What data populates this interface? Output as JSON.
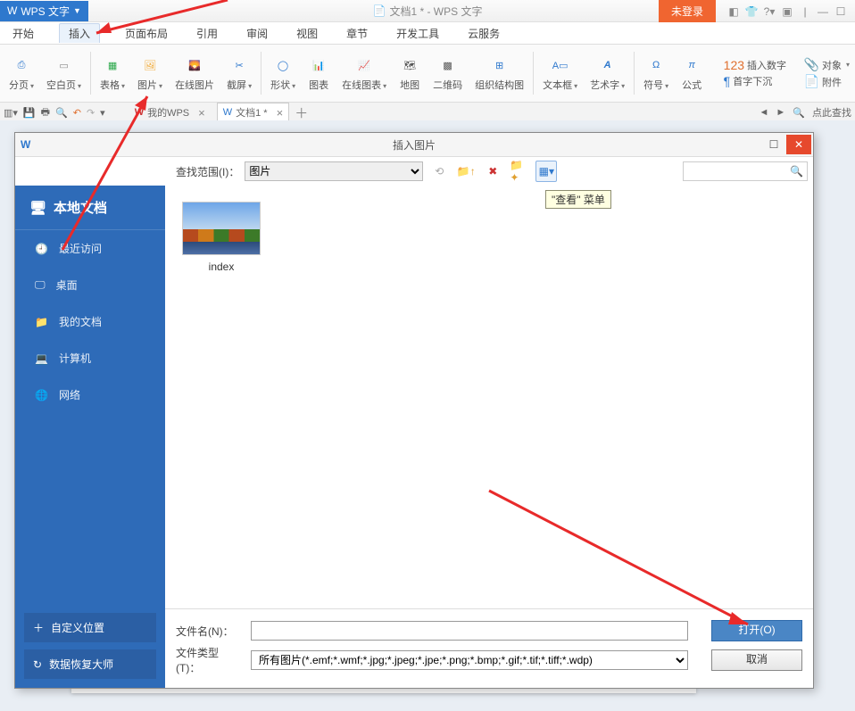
{
  "title": {
    "app": "WPS 文字",
    "doc": "文档1 * - WPS 文字",
    "login": "未登录"
  },
  "menu": {
    "items": [
      "开始",
      "插入",
      "页面布局",
      "引用",
      "审阅",
      "视图",
      "章节",
      "开发工具",
      "云服务"
    ],
    "active": 1
  },
  "ribbon": {
    "groups": [
      {
        "label": "分页",
        "drop": true
      },
      {
        "label": "空白页",
        "drop": true
      },
      {
        "label": "表格",
        "drop": true
      },
      {
        "label": "图片",
        "drop": true
      },
      {
        "label": "在线图片"
      },
      {
        "label": "截屏",
        "drop": true
      },
      {
        "label": "形状",
        "drop": true
      },
      {
        "label": "图表"
      },
      {
        "label": "在线图表",
        "drop": true
      },
      {
        "label": "地图"
      },
      {
        "label": "二维码"
      },
      {
        "label": "组织结构图"
      },
      {
        "label": "文本框",
        "drop": true
      },
      {
        "label": "艺术字",
        "drop": true
      },
      {
        "label": "符号",
        "drop": true
      },
      {
        "label": "公式"
      }
    ],
    "right": [
      "插入数字",
      "对象",
      "首字下沉",
      "附件"
    ]
  },
  "qat": {
    "tab1": "我的WPS",
    "tab2": "文档1 *",
    "search": "点此查找"
  },
  "dialog": {
    "title": "插入图片",
    "scope_label": "查找范围(I)：",
    "scope_value": "图片",
    "tooltip": "\"查看\" 菜单",
    "sidebar": {
      "header": "本地文档",
      "items": [
        "最近访问",
        "桌面",
        "我的文档",
        "计算机",
        "网络"
      ],
      "custom": "自定义位置",
      "recover": "数据恢复大师"
    },
    "file": {
      "name": "index"
    },
    "filename_label": "文件名(N)：",
    "filename_value": "",
    "filetype_label": "文件类型(T)：",
    "filetype_value": "所有图片(*.emf;*.wmf;*.jpg;*.jpeg;*.jpe;*.png;*.bmp;*.gif;*.tif;*.tiff;*.wdp)",
    "open": "打开(O)",
    "cancel": "取消"
  }
}
